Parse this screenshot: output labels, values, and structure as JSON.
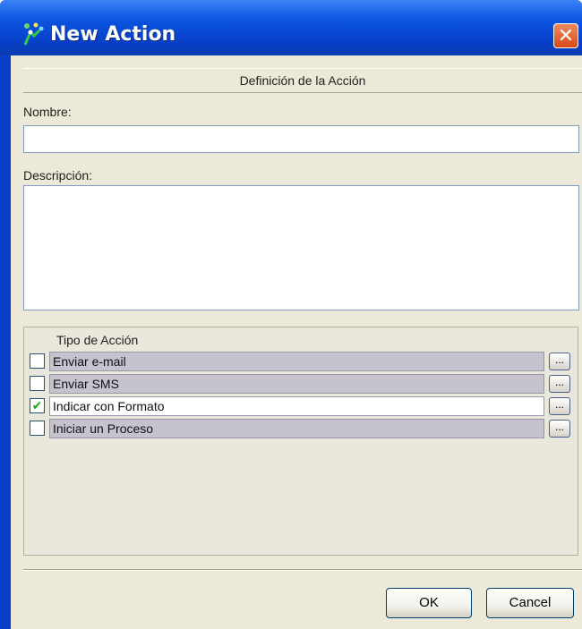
{
  "window": {
    "title": "New Action",
    "close_glyph": "✕"
  },
  "dialog": {
    "section_header": "Definición de la Acción",
    "name_label": "Nombre:",
    "name_value": "",
    "description_label": "Descripción:",
    "description_value": "",
    "action_type_header": "Tipo de Acción",
    "action_types": [
      {
        "label": "Enviar e-mail",
        "checked": false,
        "selected": false,
        "button": "..."
      },
      {
        "label": "Enviar SMS",
        "checked": false,
        "selected": false,
        "button": "..."
      },
      {
        "label": "Indicar con Formato",
        "checked": true,
        "selected": true,
        "button": "..."
      },
      {
        "label": "Iniciar un Proceso",
        "checked": false,
        "selected": false,
        "button": "..."
      }
    ]
  },
  "buttons": {
    "ok": "OK",
    "cancel": "Cancel"
  },
  "colors": {
    "titlebar": "#0b55e0",
    "client_bg": "#ece9d8",
    "row_bg": "#c6c3cf",
    "close_btn": "#d94a1a"
  }
}
